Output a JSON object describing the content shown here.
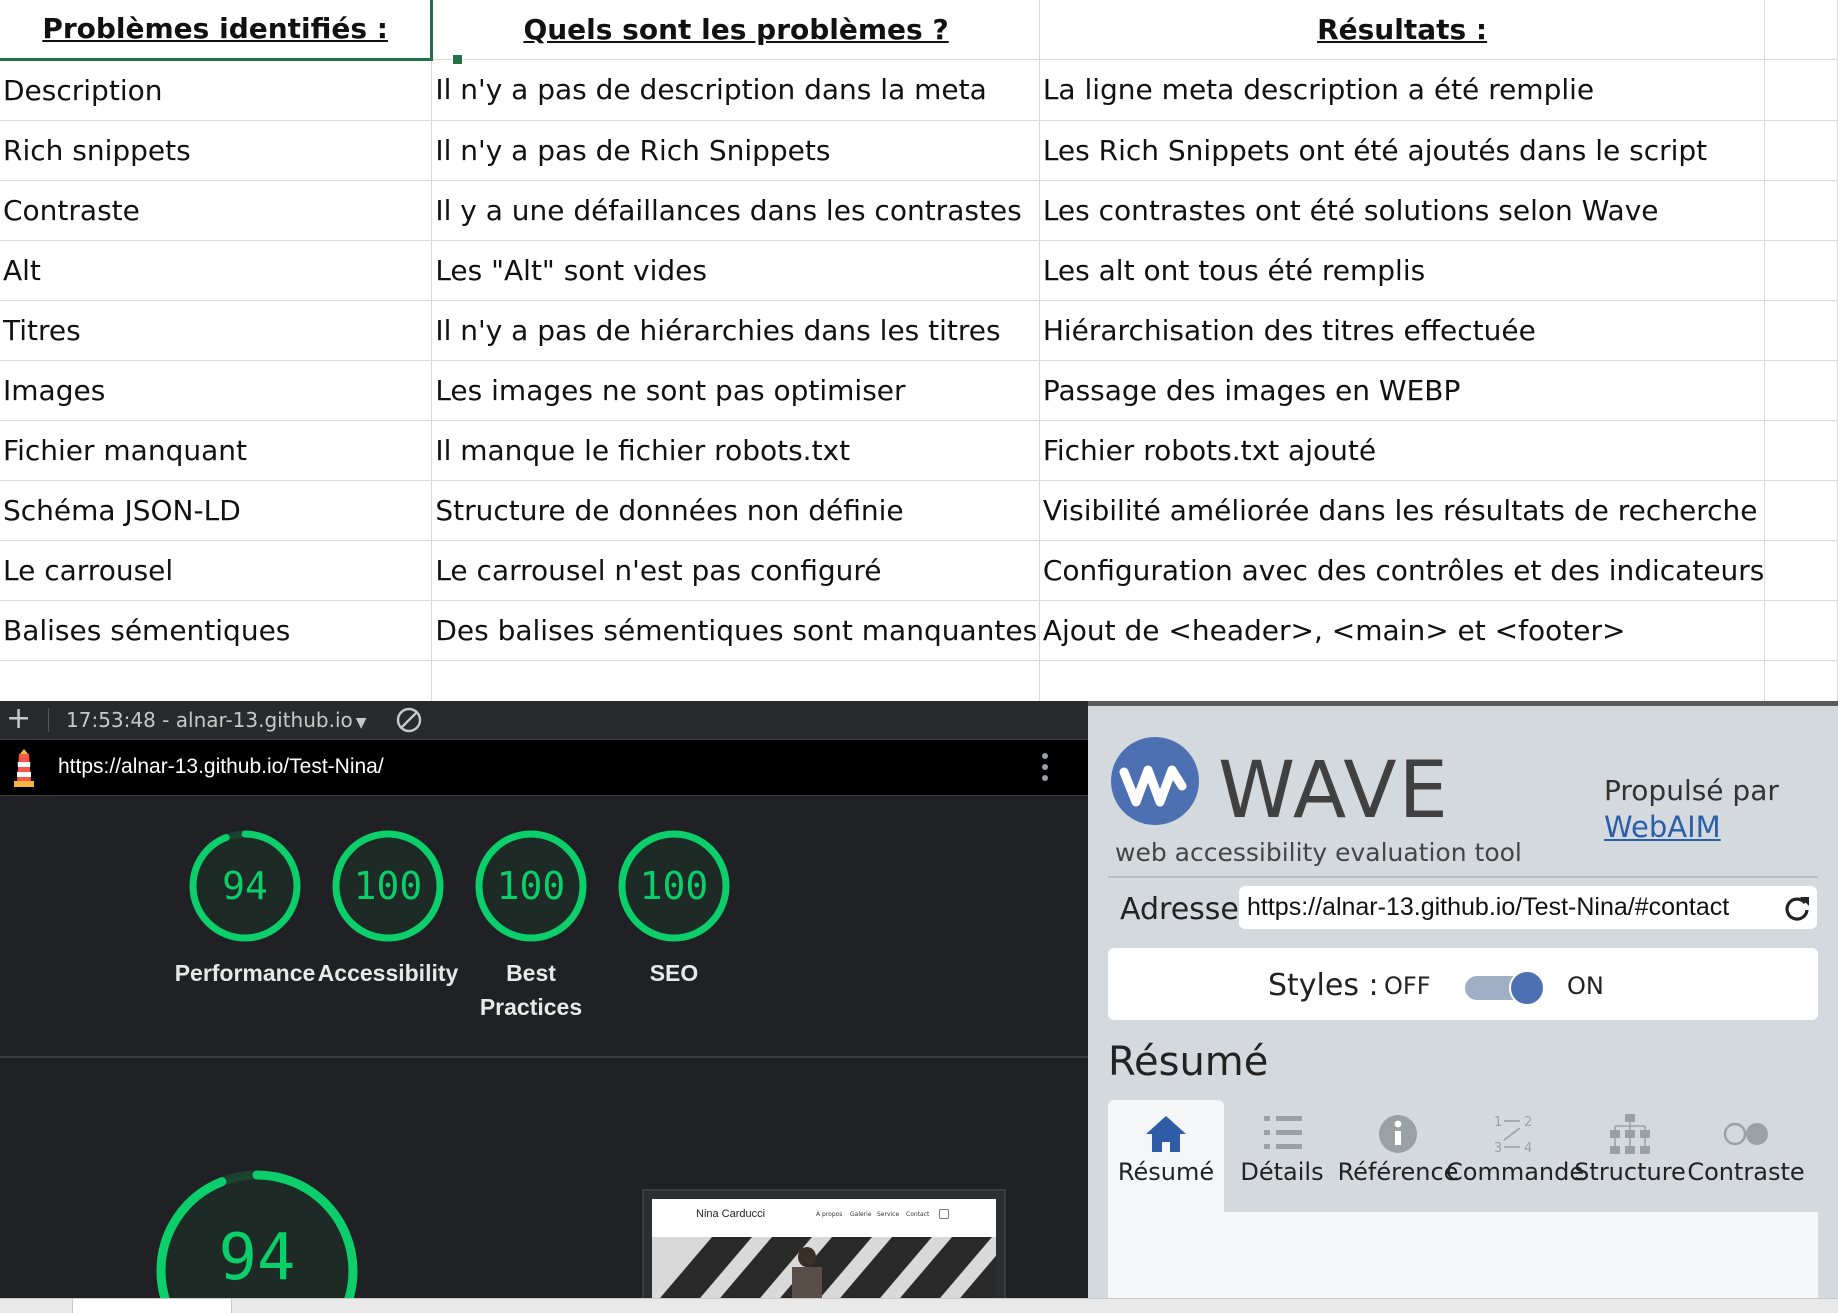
{
  "sheet": {
    "headers": [
      "Problèmes identifiés :",
      "Quels sont les problèmes ?",
      "Résultats :"
    ],
    "rows": [
      [
        "Description",
        "Il n'y a pas de description dans la meta",
        "La ligne meta description a été remplie"
      ],
      [
        "Rich snippets",
        "Il n'y a pas de Rich Snippets",
        "Les Rich Snippets ont été ajoutés dans le script"
      ],
      [
        "Contraste",
        "Il y a une défaillances dans les contrastes",
        "Les contrastes ont été solutions selon Wave"
      ],
      [
        "Alt",
        "Les \"Alt\" sont vides",
        "Les alt ont tous été remplis"
      ],
      [
        "Titres",
        "Il n'y a pas de hiérarchies dans les titres",
        "Hiérarchisation des titres effectuée"
      ],
      [
        "Images",
        "Les images ne sont pas optimiser",
        "Passage des images en WEBP"
      ],
      [
        "Fichier manquant",
        "Il manque le fichier robots.txt",
        "Fichier robots.txt ajouté"
      ],
      [
        "Schéma JSON-LD",
        "Structure de données non définie",
        "Visibilité améliorée dans les résultats de recherche"
      ],
      [
        "Le carrousel",
        "Le carrousel n'est pas configuré",
        "Configuration avec des contrôles et des indicateurs"
      ],
      [
        "Balises sémentiques",
        "Des balises sémentiques sont manquantes",
        "Ajout de <header>, <main> et <footer>"
      ]
    ]
  },
  "lighthouse": {
    "report_label": "17:53:48 - alnar-13.github.io",
    "url": "https://alnar-13.github.io/Test-Nina/",
    "scores": [
      {
        "value": 94,
        "label": "Performance"
      },
      {
        "value": 100,
        "label": "Accessibility"
      },
      {
        "value": 100,
        "label": "Best Practices"
      },
      {
        "value": 100,
        "label": "SEO"
      }
    ],
    "main_score": 94,
    "accent": "#0cce6b",
    "preview": {
      "site_name": "Nina Carducci",
      "nav": [
        "À propos",
        "Galerie",
        "Service",
        "Contact"
      ]
    }
  },
  "wave": {
    "title": "WAVE",
    "subtitle": "web accessibility evaluation tool",
    "powered_by": "Propulsé par",
    "powered_link": "WebAIM",
    "address_label": "Adresse:",
    "address_value": "https://alnar-13.github.io/Test-Nina/#contact",
    "styles_label": "Styles :",
    "styles_off": "OFF",
    "styles_on": "ON",
    "styles_enabled": true,
    "summary_title": "Résumé",
    "tabs": [
      {
        "label": "Résumé",
        "icon": "home-icon",
        "active": true
      },
      {
        "label": "Détails",
        "icon": "list-icon",
        "active": false
      },
      {
        "label": "Référence",
        "icon": "info-icon",
        "active": false
      },
      {
        "label": "Commande",
        "icon": "order-icon",
        "active": false
      },
      {
        "label": "Structure",
        "icon": "structure-icon",
        "active": false
      },
      {
        "label": "Contraste",
        "icon": "contrast-icon",
        "active": false
      }
    ],
    "brand_color": "#4d70b2"
  }
}
